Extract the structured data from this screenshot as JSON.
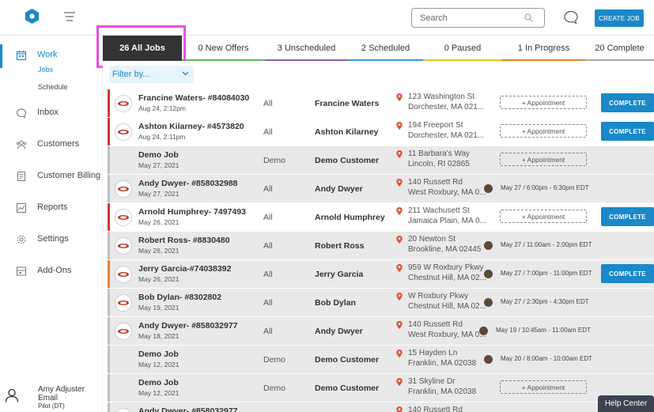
{
  "header": {
    "search_placeholder": "Search",
    "create_job_label": "CREATE JOB",
    "accent": "#1a88c9"
  },
  "sidebar": {
    "items": [
      {
        "label": "Work",
        "icon": "calendar-icon",
        "active": true
      },
      {
        "label": "Inbox",
        "icon": "chat-icon"
      },
      {
        "label": "Customers",
        "icon": "customers-icon"
      },
      {
        "label": "Customer Billing",
        "icon": "billing-icon"
      },
      {
        "label": "Reports",
        "icon": "reports-icon"
      },
      {
        "label": "Settings",
        "icon": "gear-icon"
      },
      {
        "label": "Add-Ons",
        "icon": "addons-icon"
      }
    ],
    "subitems": [
      {
        "label": "Jobs",
        "active": true
      },
      {
        "label": "Schedule"
      }
    ],
    "user": {
      "name": "Amy Adjuster",
      "email": "Email",
      "plan": "Pilot (DT)"
    }
  },
  "tabs": [
    {
      "label": "26 All Jobs",
      "active": true,
      "color": "#333333"
    },
    {
      "label": "0 New Offers",
      "color": "#5cb85c"
    },
    {
      "label": "3 Unscheduled",
      "color": "#9b59b6"
    },
    {
      "label": "2 Scheduled",
      "color": "#3498db"
    },
    {
      "label": "0 Paused",
      "color": "#f1c40f"
    },
    {
      "label": "1 In Progress",
      "color": "#e67e22"
    },
    {
      "label": "20 Complete",
      "color": "#aaaaaa"
    }
  ],
  "filter": {
    "label": "Filter by..."
  },
  "jobs": [
    {
      "title": "Francine Waters- #84084030",
      "date": "Aug 24, 2:12pm",
      "type": "All",
      "customer": "Francine Waters",
      "addr1": "123 Washington St",
      "addr2": "Dorchester, MA 021...",
      "appointment": "+ Appointment",
      "schedule": "",
      "complete": "COMPLETE",
      "stripe": "#e0312f",
      "white": true,
      "logo": true
    },
    {
      "title": "Ashton Kilarney- #4573820",
      "date": "Aug 24, 2:11pm",
      "type": "All",
      "customer": "Ashton Kilarney",
      "addr1": "194 Freeport St",
      "addr2": "Dorchester, MA 021...",
      "appointment": "+ Appointment",
      "schedule": "",
      "complete": "COMPLETE",
      "stripe": "#e0312f",
      "white": true,
      "logo": true
    },
    {
      "title": "Demo Job",
      "date": "May 27, 2021",
      "type": "Demo",
      "customer": "Demo Customer",
      "addr1": "11 Barbara's Way",
      "addr2": "Lincoln, RI 02865",
      "appointment": "+ Appointment",
      "schedule": "",
      "complete": "",
      "stripe": "#b8bfc6",
      "white": false,
      "logo": false
    },
    {
      "title": "Andy Dwyer- #858032988",
      "date": "May 27, 2021",
      "type": "All",
      "customer": "Andy Dwyer",
      "addr1": "140 Russett Rd",
      "addr2": "West Roxbury, MA 0...",
      "appointment": "",
      "schedule": "May 27 / 6:00pm - 6:30pm EDT",
      "complete": "",
      "stripe": "#b8bfc6",
      "white": false,
      "logo": true
    },
    {
      "title": "Arnold Humphrey- 7497493",
      "date": "May 26, 2021",
      "type": "All",
      "customer": "Arnold Humphrey",
      "addr1": "211 Wachusett St",
      "addr2": "Jamaica Plain, MA 0...",
      "appointment": "+ Appointment",
      "schedule": "",
      "complete": "COMPLETE",
      "stripe": "#e0312f",
      "white": true,
      "logo": true
    },
    {
      "title": "Robert Ross- #8830480",
      "date": "May 26, 2021",
      "type": "All",
      "customer": "Robert Ross",
      "addr1": "20 Newton St",
      "addr2": "Brookline, MA 02445",
      "appointment": "",
      "schedule": "May 27 / 11:00am - 2:00pm EDT",
      "complete": "",
      "stripe": "#b8bfc6",
      "white": false,
      "logo": true
    },
    {
      "title": "Jerry Garcia-#74038392",
      "date": "May 26, 2021",
      "type": "All",
      "customer": "Jerry Garcia",
      "addr1": "959 W Roxbury Pkwy",
      "addr2": "Chestnut Hill, MA 02...",
      "appointment": "",
      "schedule": "May 27 / 7:00pm - 11:00pm EDT",
      "complete": "COMPLETE",
      "stripe": "#e8833a",
      "white": false,
      "logo": true
    },
    {
      "title": "Bob Dylan- #8302802",
      "date": "May 19, 2021",
      "type": "All",
      "customer": "Bob Dylan",
      "addr1": "W Roxbury Pkwy",
      "addr2": "Chestnut Hill, MA 02...",
      "appointment": "",
      "schedule": "May 27 / 2:30pm - 4:30pm EDT",
      "complete": "",
      "stripe": "#b8bfc6",
      "white": false,
      "logo": true
    },
    {
      "title": "Andy Dwyer- #858032977",
      "date": "May 18, 2021",
      "type": "All",
      "customer": "Andy Dwyer",
      "addr1": "140 Russett Rd",
      "addr2": "West Roxbury, MA 0...",
      "appointment": "",
      "schedule": "May 19 / 10:45am - 11:00am EDT",
      "complete": "",
      "stripe": "#b8bfc6",
      "white": false,
      "logo": true
    },
    {
      "title": "Demo Job",
      "date": "May 12, 2021",
      "type": "Demo",
      "customer": "Demo Customer",
      "addr1": "15 Hayden Ln",
      "addr2": "Franklin, MA 02038",
      "appointment": "",
      "schedule": "May 20 / 8:00am - 10:00am EDT",
      "complete": "",
      "stripe": "#b8bfc6",
      "white": false,
      "logo": false
    },
    {
      "title": "Demo Job",
      "date": "May 12, 2021",
      "type": "Demo",
      "customer": "Demo Customer",
      "addr1": "31 Skyline Dr",
      "addr2": "Franklin, MA 02038",
      "appointment": "+ Appointment",
      "schedule": "",
      "complete": "",
      "stripe": "#b8bfc6",
      "white": false,
      "logo": false
    },
    {
      "title": "Andy Dwyer- #858032977",
      "date": "",
      "type": "",
      "customer": "",
      "addr1": "140 Russett Rd",
      "addr2": "",
      "appointment": "",
      "schedule": "",
      "complete": "",
      "stripe": "#b8bfc6",
      "white": false,
      "logo": true
    }
  ],
  "help_center": "Help Center"
}
